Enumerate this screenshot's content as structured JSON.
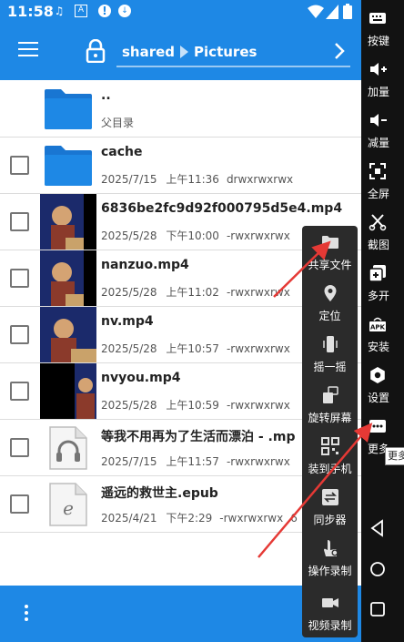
{
  "status_bar": {
    "time": "11:58"
  },
  "toolbar": {
    "path": [
      "shared",
      "Pictures"
    ]
  },
  "files": [
    {
      "name": "..",
      "meta": [
        "父目录"
      ],
      "kind": "folder",
      "checkbox": false
    },
    {
      "name": "cache",
      "meta": [
        "2025/7/15 上午11:36",
        "drwxrwxrwx"
      ],
      "kind": "folder",
      "checkbox": true
    },
    {
      "name": "6836be2fc9d92f000795d5e4.mp4",
      "meta": [
        "2025/5/28 下午10:00",
        "-rwxrwxrwx"
      ],
      "kind": "video",
      "checkbox": true
    },
    {
      "name": "nanzuo.mp4",
      "meta": [
        "2025/5/28 上午11:02",
        "-rwxrwxrwx"
      ],
      "kind": "video",
      "checkbox": true
    },
    {
      "name": "nv.mp4",
      "meta": [
        "2025/5/28 上午10:57",
        "-rwxrwxrwx"
      ],
      "kind": "video",
      "checkbox": true
    },
    {
      "name": "nvyou.mp4",
      "meta": [
        "2025/5/28 上午10:59",
        "-rwxrwxrwx"
      ],
      "kind": "video-narrow",
      "checkbox": true
    },
    {
      "name": "等我不用再为了生活而漂泊 - .mp",
      "meta": [
        "2025/7/15 上午11:57",
        "-rwxrwxrwx"
      ],
      "kind": "audio",
      "checkbox": true
    },
    {
      "name": "遥远的救世主.epub",
      "meta": [
        "2025/4/21 下午2:29",
        "-rwxrwxrwx",
        "6"
      ],
      "kind": "epub",
      "checkbox": true
    }
  ],
  "float_menu": [
    {
      "label": "共享文件",
      "icon": "folder-icon"
    },
    {
      "label": "定位",
      "icon": "location-pin-icon"
    },
    {
      "label": "摇一摇",
      "icon": "shake-phone-icon"
    },
    {
      "label": "旋转屏幕",
      "icon": "rotate-screen-icon"
    },
    {
      "label": "装到手机",
      "icon": "qr-code-icon"
    },
    {
      "label": "同步器",
      "icon": "sync-icon"
    },
    {
      "label": "操作录制",
      "icon": "macro-record-icon"
    },
    {
      "label": "视频录制",
      "icon": "video-camera-icon"
    }
  ],
  "sidebar": [
    {
      "label": "按键",
      "icon": "keyboard-icon"
    },
    {
      "label": "加量",
      "icon": "volume-up-icon"
    },
    {
      "label": "减量",
      "icon": "volume-down-icon"
    },
    {
      "label": "全屏",
      "icon": "fullscreen-icon"
    },
    {
      "label": "截图",
      "icon": "scissors-icon"
    },
    {
      "label": "多开",
      "icon": "multi-instance-icon"
    },
    {
      "label": "安装",
      "icon": "apk-icon"
    },
    {
      "label": "设置",
      "icon": "settings-gear-icon"
    },
    {
      "label": "更多",
      "icon": "more-icon"
    }
  ],
  "tooltip": "更多"
}
